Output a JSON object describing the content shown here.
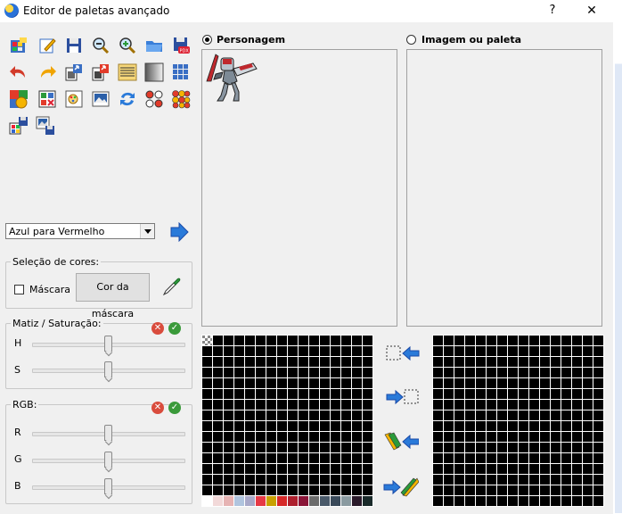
{
  "window": {
    "title": "Editor de paletas avançado",
    "help": "?",
    "close": "✕"
  },
  "toolbar": {
    "icons": [
      "new-palette-icon",
      "edit-icon",
      "save-icon",
      "zoom-out-icon",
      "zoom-in-icon",
      "open-folder-icon",
      "save-pdx-icon",
      "undo-icon",
      "redo-icon",
      "import-icon",
      "export-icon",
      "gradient-map-icon",
      "gradient-icon",
      "grid-icon",
      "colors-icon",
      "remove-color-icon",
      "color-picker-tool-icon",
      "image-icon",
      "swap-icon",
      "sort-colors-icon",
      "color-balls-icon",
      "copy-palette-icon",
      "paste-image-icon"
    ]
  },
  "preset": {
    "value": "Azul para Vermelho"
  },
  "color_selection": {
    "title": "Seleção de cores:",
    "mask_label": "Máscara",
    "mask_color_button": "Cor da máscara"
  },
  "hue_sat": {
    "title": "Matiz / Saturação:",
    "h_label": "H",
    "s_label": "S",
    "h_value": 0.5,
    "s_value": 0.5
  },
  "rgb": {
    "title": "RGB:",
    "r_label": "R",
    "g_label": "G",
    "b_label": "B",
    "r_value": 0.5,
    "g_value": 0.5,
    "b_value": 0.5
  },
  "panels": {
    "left_radio": "Personagem",
    "right_radio": "Imagem ou paleta",
    "selected": "Personagem"
  },
  "palette_left_bottom_colors": [
    "#ffffff",
    "#f2d9d9",
    "#e6b3b3",
    "#b0c4de",
    "#a9a9c9",
    "#e63946",
    "#c8a000",
    "#d62828",
    "#ad1f2d",
    "#8a1538",
    "#6b6b6b",
    "#4a5a6a",
    "#3a4a5a",
    "#8a9aa0",
    "#2a1a2a",
    "#1a2a2a"
  ],
  "colors": {
    "confirm": "#3a9a3a",
    "cancel": "#d94c3d",
    "accent": "#1e6fd9"
  }
}
